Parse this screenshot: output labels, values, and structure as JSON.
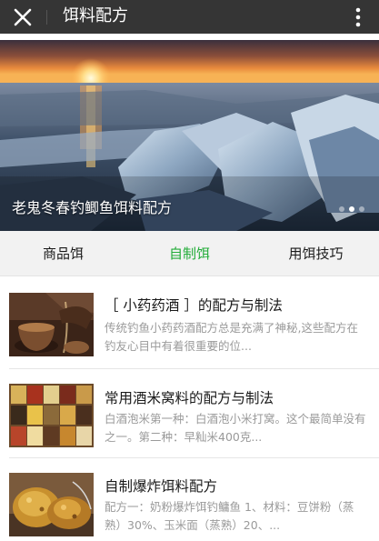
{
  "topbar": {
    "title": "饵料配方",
    "close_icon": "close-icon",
    "more_icon": "more-vertical-icon"
  },
  "banner": {
    "caption": "老鬼冬春钓鲫鱼饵料配方",
    "slide_count": 3,
    "active_slide": 2
  },
  "tabs": [
    {
      "label": "商品饵",
      "active": false
    },
    {
      "label": "自制饵",
      "active": true
    },
    {
      "label": "用饵技巧",
      "active": false
    }
  ],
  "articles": [
    {
      "title": "［ 小药药酒 ］的配方与制法",
      "desc": "传统钓鱼小药药酒配方总是充满了神秘,这些配方在钓友心目中有着很重要的位..."
    },
    {
      "title": "常用酒米窝料的配方与制法",
      "desc": "白酒泡米第一种：白酒泡小米打窝。这个最简单没有之一。第二种：早籼米400克..."
    },
    {
      "title": "自制爆炸饵料配方",
      "desc": "配方一：奶粉爆炸饵钓鳙鱼 1、材料：豆饼粉（蒸熟）30%、玉米面（蒸熟）20、..."
    }
  ],
  "colors": {
    "topbar_bg": "#353535",
    "tab_active": "#22ac38",
    "tabs_bg": "#f2f2f2",
    "desc_text": "#9a9a9a"
  }
}
